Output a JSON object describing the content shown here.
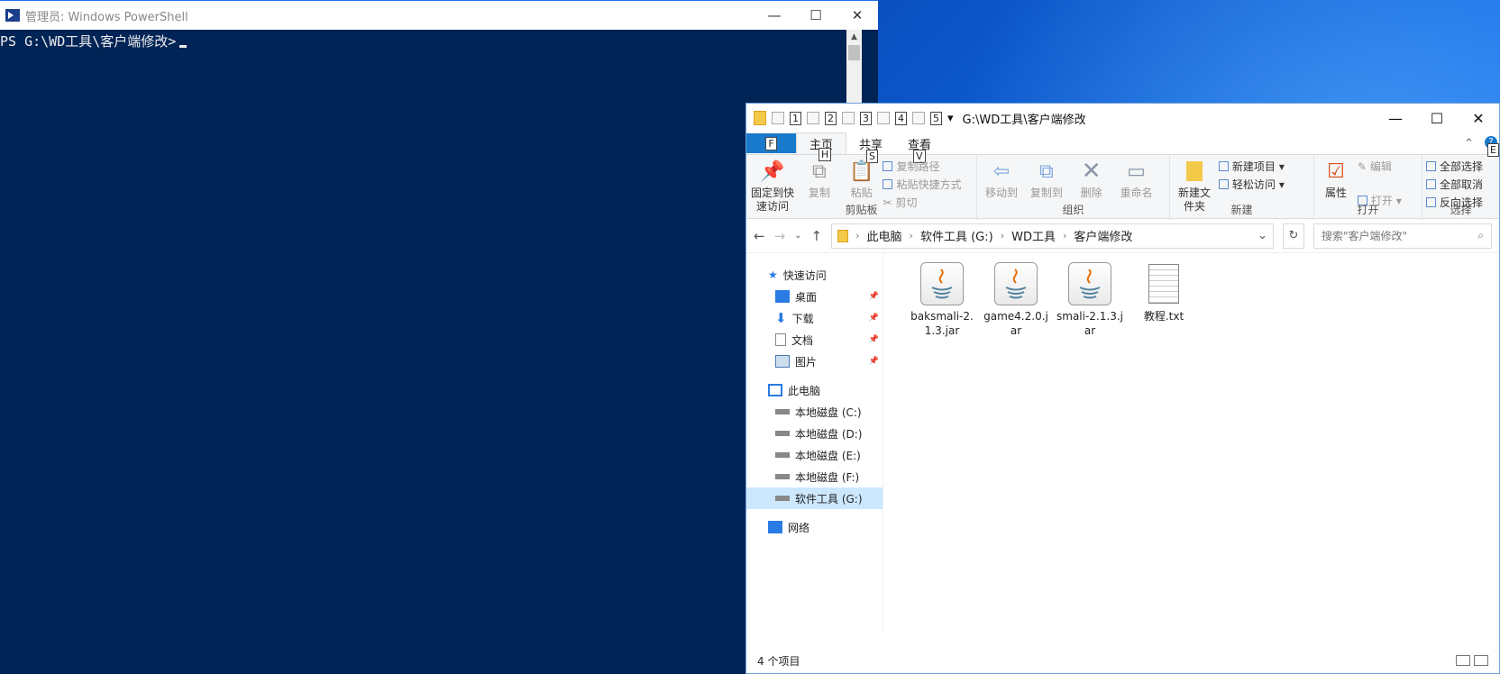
{
  "powershell": {
    "title": "管理员: Windows PowerShell",
    "prompt": "PS G:\\WD工具\\客户端修改>",
    "min": "—",
    "max": "☐",
    "close": "✕"
  },
  "explorer": {
    "title_path": "G:\\WD工具\\客户端修改",
    "qa_keytips": [
      "1",
      "2",
      "3",
      "4",
      "5"
    ],
    "min": "—",
    "max": "☐",
    "close": "✕",
    "tabs": {
      "file": "文件",
      "file_key": "F",
      "home": "主页",
      "home_key": "H",
      "share": "共享",
      "share_key": "S",
      "view": "查看",
      "view_key": "V",
      "help_key": "E"
    },
    "ribbon": {
      "clipboard": {
        "label": "剪贴板",
        "pin": "固定到快速访问",
        "copy": "复制",
        "paste": "粘贴",
        "copy_path": "复制路径",
        "paste_shortcut": "粘贴快捷方式",
        "cut": "剪切"
      },
      "organize": {
        "label": "组织",
        "move_to": "移动到",
        "copy_to": "复制到",
        "delete": "删除",
        "rename": "重命名"
      },
      "new": {
        "label": "新建",
        "new_folder": "新建文件夹",
        "new_item": "新建项目",
        "easy_access": "轻松访问"
      },
      "open": {
        "label": "打开",
        "properties": "属性",
        "open": "打开",
        "edit": "编辑"
      },
      "select": {
        "label": "选择",
        "select_all": "全部选择",
        "select_none": "全部取消",
        "invert": "反向选择"
      }
    },
    "address": {
      "crumbs": [
        "此电脑",
        "软件工具 (G:)",
        "WD工具",
        "客户端修改"
      ],
      "search_placeholder": "搜索\"客户端修改\""
    },
    "tree": {
      "quick_access": "快速访问",
      "quick_items": [
        "桌面",
        "下载",
        "文档",
        "图片"
      ],
      "this_pc": "此电脑",
      "drives": [
        "本地磁盘 (C:)",
        "本地磁盘 (D:)",
        "本地磁盘 (E:)",
        "本地磁盘 (F:)",
        "软件工具 (G:)"
      ],
      "network": "网络"
    },
    "files": [
      {
        "name": "baksmali-2.1.3.jar",
        "type": "jar"
      },
      {
        "name": "game4.2.0.jar",
        "type": "jar"
      },
      {
        "name": "smali-2.1.3.jar",
        "type": "jar"
      },
      {
        "name": "教程.txt",
        "type": "txt"
      }
    ],
    "status": "4 个项目"
  }
}
